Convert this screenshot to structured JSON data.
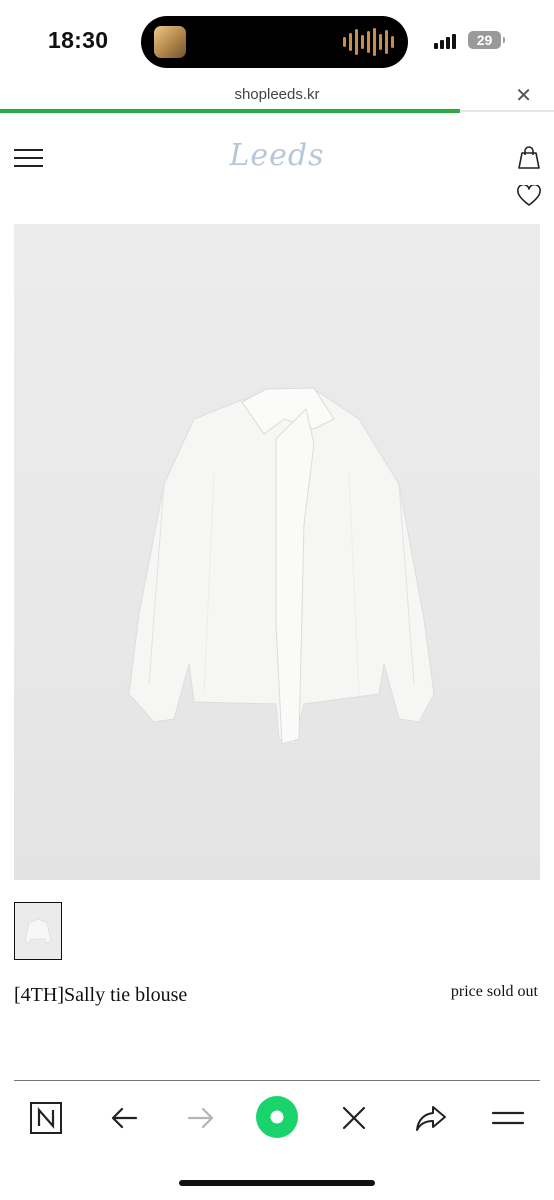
{
  "status_bar": {
    "time": "18:30",
    "battery_level": "29",
    "signal_icon": "cellular-signal-icon",
    "battery_icon": "battery-icon",
    "now_playing_icon": "waveform-icon"
  },
  "browser": {
    "url": "shopleeds.kr",
    "close_icon": "close-icon",
    "load_progress": 0.83,
    "progress_color": "#27ae43"
  },
  "header": {
    "logo_text": "Leeds",
    "menu_icon": "hamburger-menu-icon",
    "cart_icon": "shopping-bag-icon",
    "wishlist_icon": "heart-icon"
  },
  "product": {
    "name": "[4TH]Sally tie blouse",
    "price": "price sold out",
    "image_alt": "white tie blouse"
  },
  "toolbar": {
    "items": [
      {
        "name": "naver-home-button",
        "icon": "naver-n-icon",
        "label": "N"
      },
      {
        "name": "back-button",
        "icon": "arrow-left-icon"
      },
      {
        "name": "forward-button",
        "icon": "arrow-right-icon"
      },
      {
        "name": "green-dot-button",
        "icon": "green-dot-icon"
      },
      {
        "name": "close-tab-button",
        "icon": "close-icon"
      },
      {
        "name": "share-button",
        "icon": "share-icon"
      },
      {
        "name": "menu-button",
        "icon": "menu-icon"
      }
    ],
    "accent_color": "#19d36b"
  }
}
